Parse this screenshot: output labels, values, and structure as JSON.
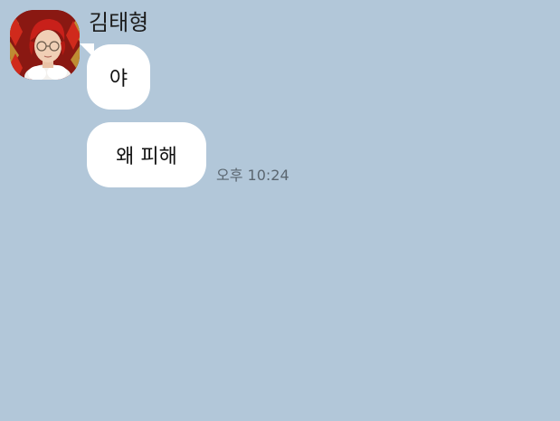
{
  "chat": {
    "sender_name": "김태형",
    "messages": [
      {
        "text": "야"
      },
      {
        "text": "왜 피해"
      }
    ],
    "timestamp": "오후 10:24"
  },
  "colors": {
    "background": "#b2c7d9",
    "bubble": "#ffffff",
    "timestamp": "#5b6670"
  }
}
